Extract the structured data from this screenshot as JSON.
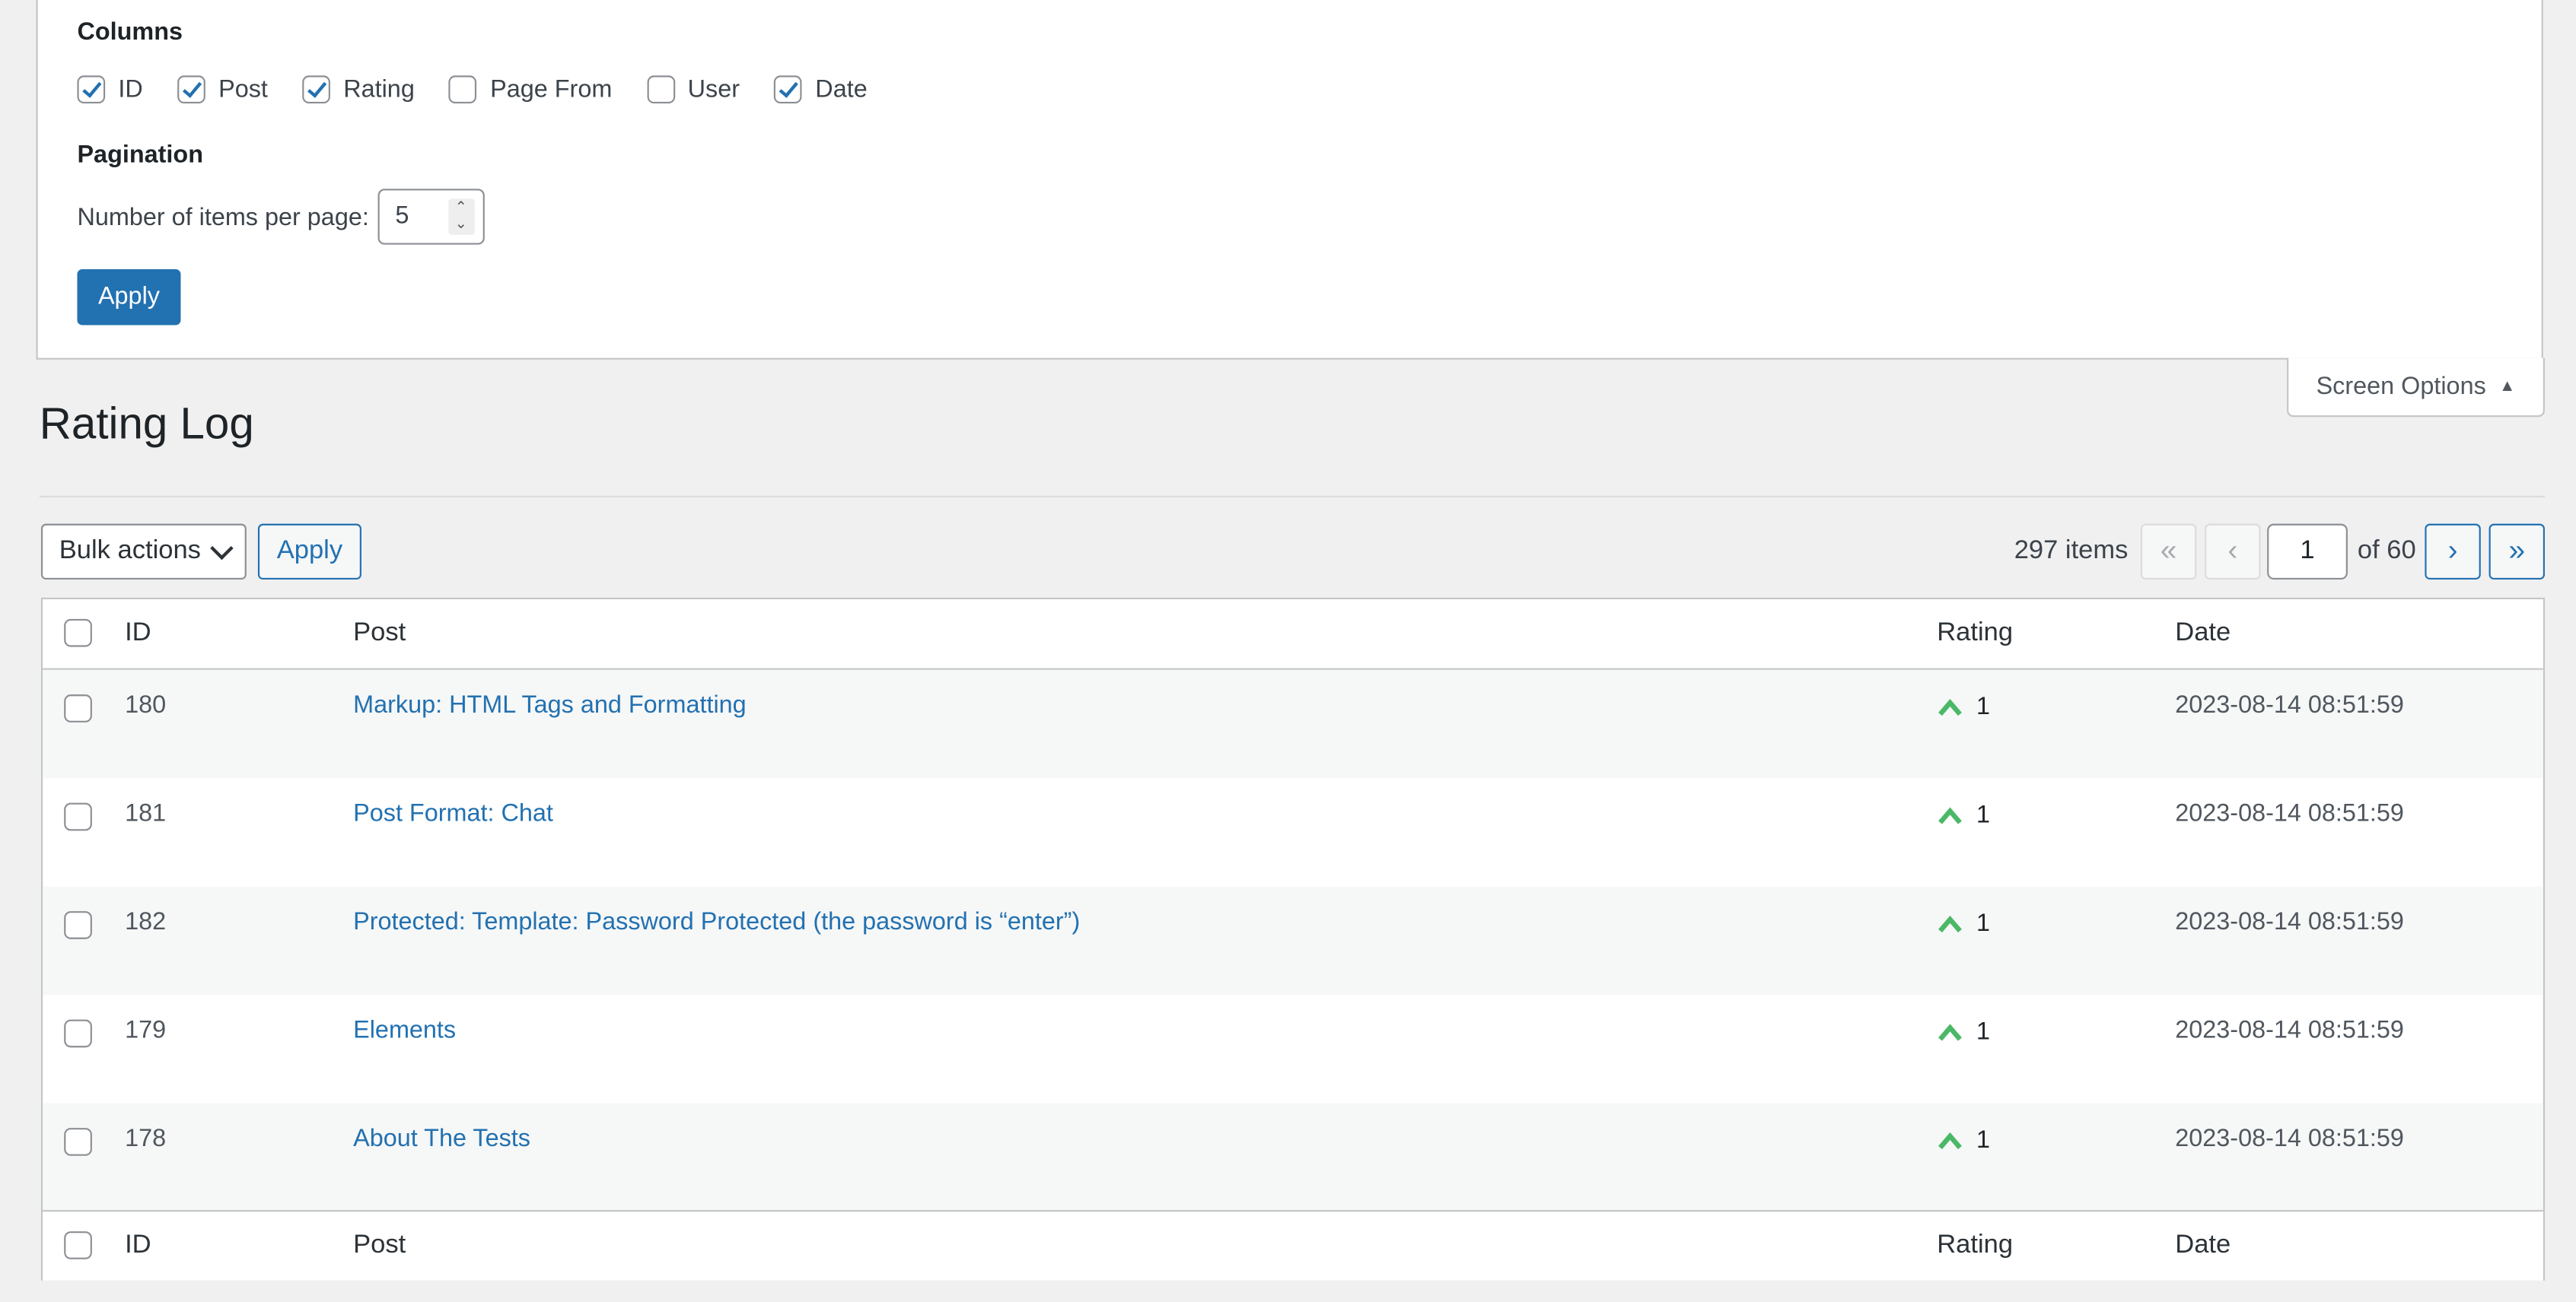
{
  "screen_options": {
    "columns_heading": "Columns",
    "columns": [
      {
        "label": "ID",
        "checked": true
      },
      {
        "label": "Post",
        "checked": true
      },
      {
        "label": "Rating",
        "checked": true
      },
      {
        "label": "Page From",
        "checked": false
      },
      {
        "label": "User",
        "checked": false
      },
      {
        "label": "Date",
        "checked": true
      }
    ],
    "pagination_heading": "Pagination",
    "per_page_label": "Number of items per page:",
    "per_page_value": "5",
    "apply_label": "Apply",
    "tab_label": "Screen Options"
  },
  "page_title": "Rating Log",
  "toolbar": {
    "bulk_actions_label": "Bulk actions",
    "apply_label": "Apply",
    "items_count": "297 items",
    "first_page": "«",
    "prev_page": "‹",
    "current_page": "1",
    "of_pages": "of 60",
    "next_page": "›",
    "last_page": "»"
  },
  "table": {
    "headers": {
      "id": "ID",
      "post": "Post",
      "rating": "Rating",
      "date": "Date"
    },
    "rows": [
      {
        "id": "180",
        "post": "Markup: HTML Tags and Formatting",
        "rating": "1",
        "date": "2023-08-14 08:51:59"
      },
      {
        "id": "181",
        "post": "Post Format: Chat",
        "rating": "1",
        "date": "2023-08-14 08:51:59"
      },
      {
        "id": "182",
        "post": "Protected: Template: Password Protected (the password is “enter”)",
        "rating": "1",
        "date": "2023-08-14 08:51:59"
      },
      {
        "id": "179",
        "post": "Elements",
        "rating": "1",
        "date": "2023-08-14 08:51:59"
      },
      {
        "id": "178",
        "post": "About The Tests",
        "rating": "1",
        "date": "2023-08-14 08:51:59"
      }
    ]
  },
  "colors": {
    "accent": "#2271b1",
    "rating_up": "#68de7c",
    "background": "#f0f0f1"
  }
}
